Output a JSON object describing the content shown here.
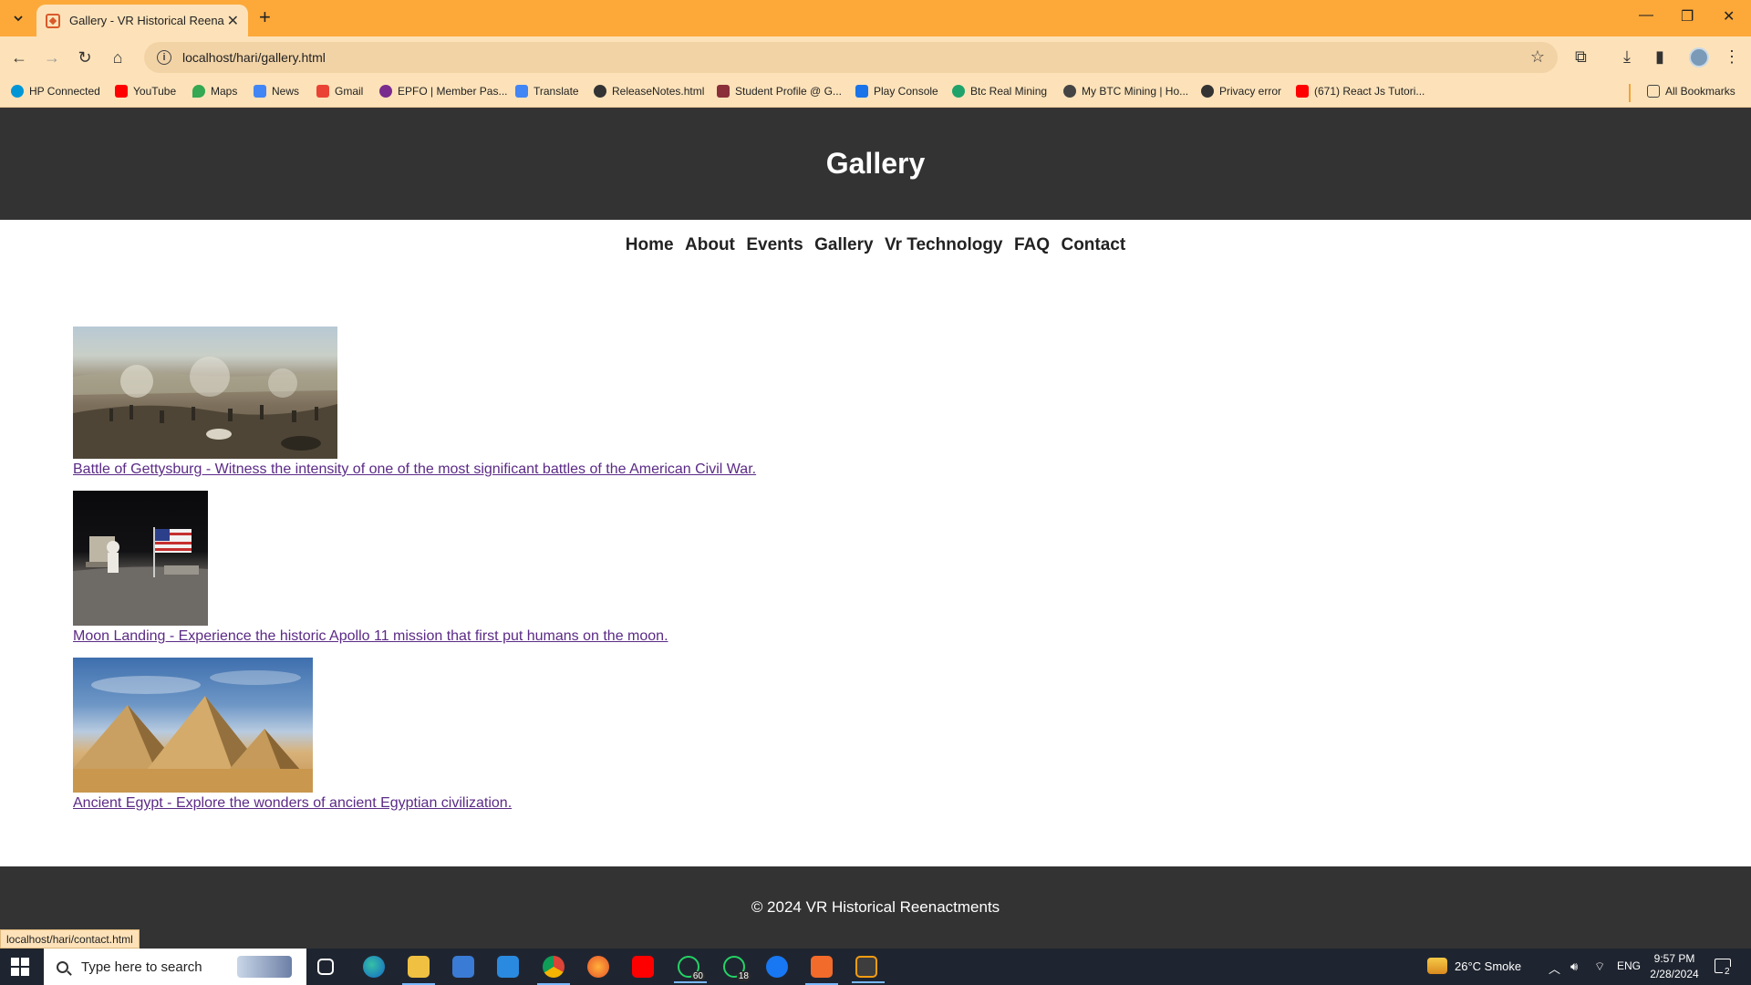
{
  "browser": {
    "tab_title": "Gallery - VR Historical Reenactments",
    "url": "localhost/hari/gallery.html",
    "status_url": "localhost/hari/contact.html",
    "all_bookmarks": "All Bookmarks",
    "bookmarks": [
      {
        "label": "HP Connected",
        "icon": "hp-icon",
        "color": "#0096d6"
      },
      {
        "label": "YouTube",
        "icon": "youtube-icon",
        "color": "#ff0000"
      },
      {
        "label": "Maps",
        "icon": "maps-icon",
        "color": "#34a853"
      },
      {
        "label": "News",
        "icon": "news-icon",
        "color": "#4285f4"
      },
      {
        "label": "Gmail",
        "icon": "gmail-icon",
        "color": "#ea4335"
      },
      {
        "label": "EPFO | Member Pas...",
        "icon": "epfo-icon",
        "color": "#7a2b8e"
      },
      {
        "label": "Translate",
        "icon": "translate-icon",
        "color": "#4285f4"
      },
      {
        "label": "ReleaseNotes.html",
        "icon": "globe-icon",
        "color": "#333333"
      },
      {
        "label": "Student Profile @ G...",
        "icon": "student-icon",
        "color": "#8b2f3a"
      },
      {
        "label": "Play Console",
        "icon": "play-console-icon",
        "color": "#1a73e8"
      },
      {
        "label": "Btc Real Mining",
        "icon": "btc-icon",
        "color": "#1fa36b"
      },
      {
        "label": "My BTC Mining | Ho...",
        "icon": "mining-icon",
        "color": "#444444"
      },
      {
        "label": "Privacy error",
        "icon": "globe-icon",
        "color": "#333333"
      },
      {
        "label": "(671) React Js Tutori...",
        "icon": "youtube-icon",
        "color": "#ff0000"
      }
    ]
  },
  "page": {
    "title": "Gallery",
    "nav": [
      "Home",
      "About",
      "Events",
      "Gallery",
      "Vr Technology",
      "FAQ",
      "Contact"
    ],
    "items": [
      {
        "caption": "Battle of Gettysburg - Witness the intensity of one of the most significant battles of the American Civil War."
      },
      {
        "caption": "Moon Landing - Experience the historic Apollo 11 mission that first put humans on the moon."
      },
      {
        "caption": "Ancient Egypt - Explore the wonders of ancient Egyptian civilization."
      }
    ],
    "footer": "© 2024 VR Historical Reenactments"
  },
  "taskbar": {
    "search_placeholder": "Type here to search",
    "weather": "26°C  Smoke",
    "language": "ENG",
    "time": "9:57 PM",
    "date": "2/28/2024",
    "whatsapp_badge_1": "60",
    "whatsapp_badge_2": "18",
    "notifications": "2"
  },
  "colors": {
    "tabstrip": "#fca93a",
    "toolbar": "#fde2b9",
    "header": "#333333",
    "link": "#5b2a86",
    "taskbar": "#1f2530"
  }
}
